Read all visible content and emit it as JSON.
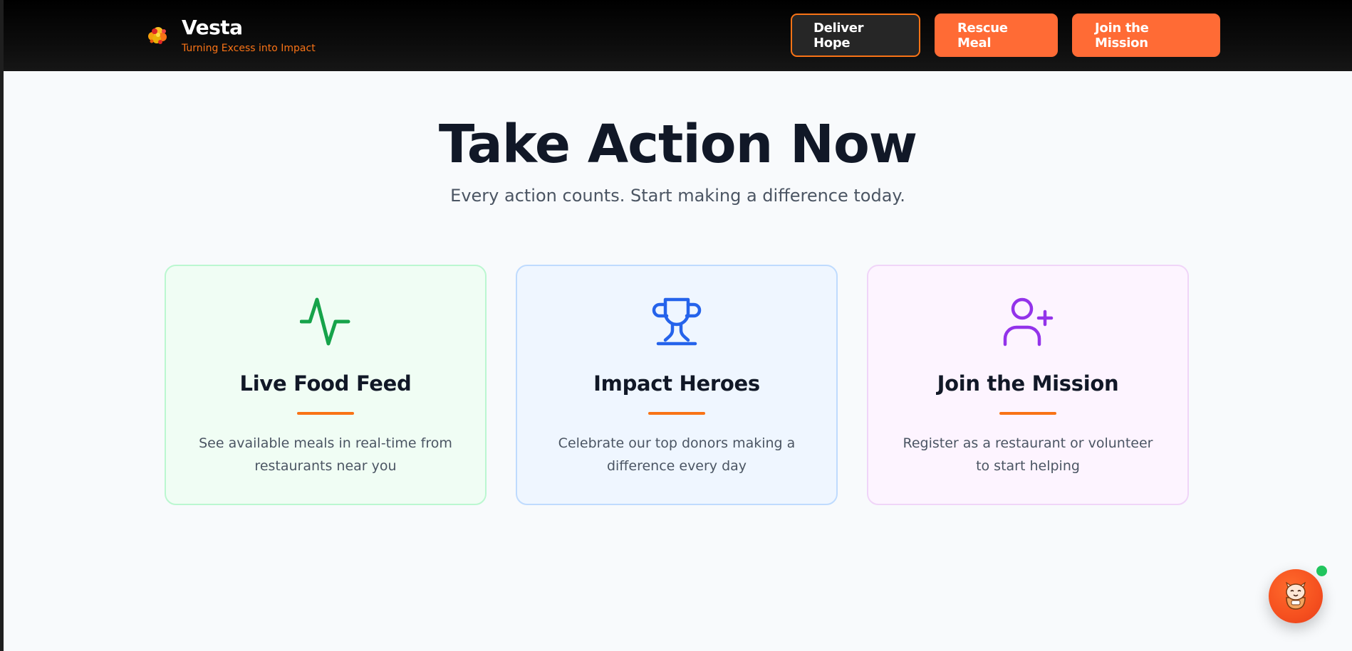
{
  "header": {
    "brand_name": "Vesta",
    "brand_tagline": "Turning Excess into Impact",
    "logo_icon": "flame-logo-icon",
    "buttons": [
      {
        "label": "Deliver Hope",
        "style": "dark"
      },
      {
        "label": "Rescue Meal",
        "style": "orange"
      },
      {
        "label": "Join the Mission",
        "style": "orange"
      }
    ]
  },
  "hero": {
    "title": "Take Action Now",
    "subtitle": "Every action counts. Start making a difference today."
  },
  "cards": [
    {
      "title": "Live Food Feed",
      "description": "See available meals in real-time from restaurants near you",
      "icon": "activity-pulse-icon",
      "accent_color": "#16a34a"
    },
    {
      "title": "Impact Heroes",
      "description": "Celebrate our top donors making a difference every day",
      "icon": "trophy-icon",
      "accent_color": "#2563eb"
    },
    {
      "title": "Join the Mission",
      "description": "Register as a restaurant or volunteer to start helping",
      "icon": "user-plus-icon",
      "accent_color": "#9333ea"
    }
  ],
  "chat": {
    "icon": "chat-assistant-avatar-icon",
    "status_color": "#22c55e"
  },
  "colors": {
    "brand_orange": "#ff6b35",
    "title_dark": "#111827",
    "divider_orange": "#f97316"
  }
}
